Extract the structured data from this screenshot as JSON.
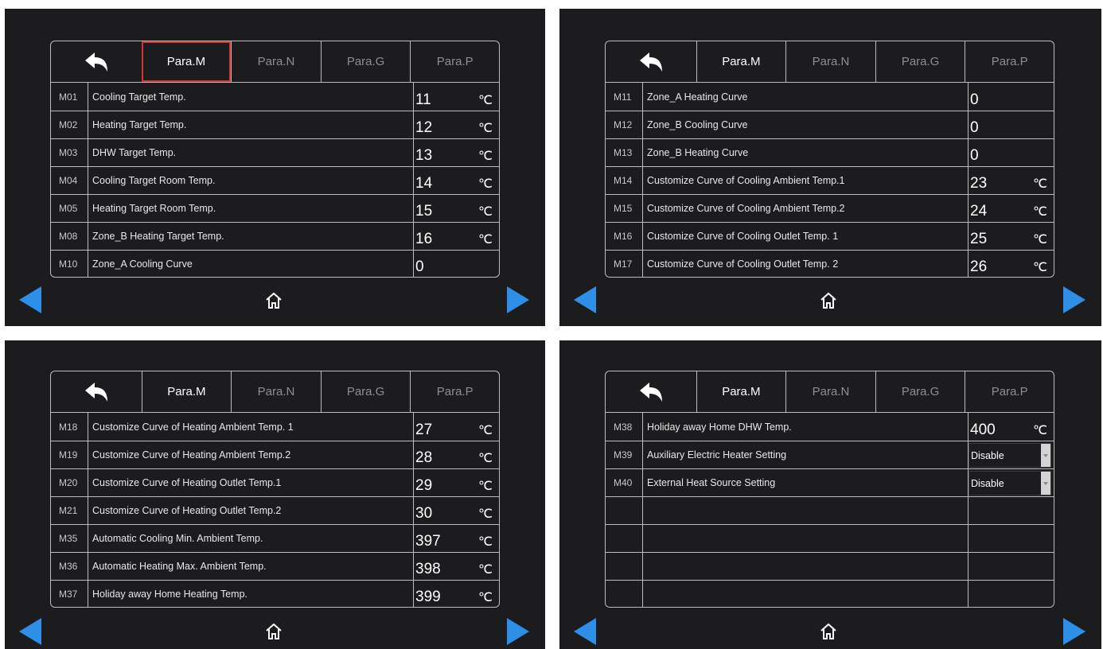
{
  "tabs": [
    "Para.M",
    "Para.N",
    "Para.G",
    "Para.P"
  ],
  "icons": {
    "back": "back-arrow-icon",
    "home": "home-icon",
    "prev": "arrow-left-icon",
    "next": "arrow-right-icon",
    "dropdown": "chevron-down-icon"
  },
  "colors": {
    "accent": "#2d8fe8",
    "selection": "#d23434",
    "background": "#1c1c1e"
  },
  "unit": "℃",
  "panels": [
    {
      "rows": [
        {
          "code": "M01",
          "name": "Cooling Target Temp.",
          "value": "11",
          "unit": "℃"
        },
        {
          "code": "M02",
          "name": "Heating Target Temp.",
          "value": "12",
          "unit": "℃"
        },
        {
          "code": "M03",
          "name": "DHW Target Temp.",
          "value": "13",
          "unit": "℃"
        },
        {
          "code": "M04",
          "name": "Cooling Target Room Temp.",
          "value": "14",
          "unit": "℃"
        },
        {
          "code": "M05",
          "name": "Heating Target Room Temp.",
          "value": "15",
          "unit": "℃"
        },
        {
          "code": "M08",
          "name": "Zone_B Heating Target Temp.",
          "value": "16",
          "unit": "℃"
        },
        {
          "code": "M10",
          "name": "Zone_A Cooling Curve",
          "value": "0",
          "unit": ""
        }
      ]
    },
    {
      "rows": [
        {
          "code": "M11",
          "name": "Zone_A Heating Curve",
          "value": "0",
          "unit": ""
        },
        {
          "code": "M12",
          "name": "Zone_B Cooling Curve",
          "value": "0",
          "unit": ""
        },
        {
          "code": "M13",
          "name": "Zone_B Heating Curve",
          "value": "0",
          "unit": ""
        },
        {
          "code": "M14",
          "name": "Customize Curve of Cooling Ambient Temp.1",
          "value": "23",
          "unit": "℃"
        },
        {
          "code": "M15",
          "name": "Customize Curve of Cooling Ambient Temp.2",
          "value": "24",
          "unit": "℃"
        },
        {
          "code": "M16",
          "name": "Customize Curve of Cooling Outlet Temp. 1",
          "value": "25",
          "unit": "℃"
        },
        {
          "code": "M17",
          "name": "Customize Curve of Cooling Outlet Temp. 2",
          "value": "26",
          "unit": "℃"
        }
      ]
    },
    {
      "rows": [
        {
          "code": "M18",
          "name": "Customize Curve of Heating Ambient Temp. 1",
          "value": "27",
          "unit": "℃"
        },
        {
          "code": "M19",
          "name": "Customize Curve of Heating Ambient Temp.2",
          "value": "28",
          "unit": "℃"
        },
        {
          "code": "M20",
          "name": "Customize Curve of Heating Outlet Temp.1",
          "value": "29",
          "unit": "℃"
        },
        {
          "code": "M21",
          "name": "Customize Curve of Heating Outlet Temp.2",
          "value": "30",
          "unit": "℃"
        },
        {
          "code": "M35",
          "name": "Automatic Cooling Min. Ambient Temp.",
          "value": "397",
          "unit": "℃"
        },
        {
          "code": "M36",
          "name": "Automatic Heating Max. Ambient Temp.",
          "value": "398",
          "unit": "℃"
        },
        {
          "code": "M37",
          "name": "Holiday away Home Heating Temp.",
          "value": "399",
          "unit": "℃"
        }
      ]
    },
    {
      "rows": [
        {
          "code": "M38",
          "name": "Holiday away Home DHW Temp.",
          "value": "400",
          "unit": "℃"
        },
        {
          "code": "M39",
          "name": "Auxiliary Electric Heater Setting",
          "select": "Disable"
        },
        {
          "code": "M40",
          "name": "External Heat Source Setting",
          "select": "Disable"
        },
        {
          "code": "",
          "name": ""
        },
        {
          "code": "",
          "name": ""
        },
        {
          "code": "",
          "name": ""
        },
        {
          "code": "",
          "name": ""
        }
      ]
    }
  ]
}
